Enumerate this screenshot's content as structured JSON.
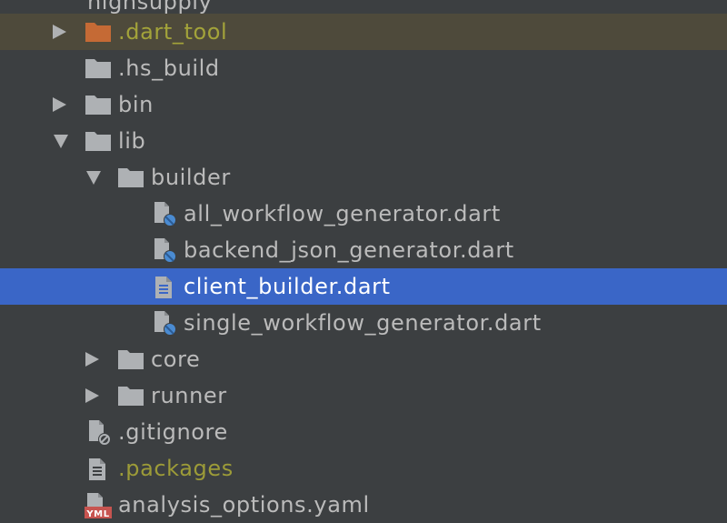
{
  "tree": {
    "root_partial": "highsupply",
    "items": [
      {
        "label": ".dart_tool",
        "icon": "folder-excluded-icon",
        "expanded": false,
        "depth": 0
      },
      {
        "label": ".hs_build",
        "icon": "folder-icon",
        "depth": 0
      },
      {
        "label": "bin",
        "icon": "folder-icon",
        "expanded": false,
        "depth": 0
      },
      {
        "label": "lib",
        "icon": "folder-icon",
        "expanded": true,
        "depth": 0
      },
      {
        "label": "builder",
        "icon": "folder-icon",
        "expanded": true,
        "depth": 1
      },
      {
        "label": "all_workflow_generator.dart",
        "icon": "dart-file-icon",
        "depth": 2
      },
      {
        "label": "backend_json_generator.dart",
        "icon": "dart-file-icon",
        "depth": 2
      },
      {
        "label": "client_builder.dart",
        "icon": "text-file-icon",
        "depth": 2,
        "selected": true
      },
      {
        "label": "single_workflow_generator.dart",
        "icon": "dart-file-icon",
        "depth": 2
      },
      {
        "label": "core",
        "icon": "folder-icon",
        "expanded": false,
        "depth": 1
      },
      {
        "label": "runner",
        "icon": "folder-icon",
        "expanded": false,
        "depth": 1
      },
      {
        "label": ".gitignore",
        "icon": "ignore-file-icon",
        "depth": 0
      },
      {
        "label": ".packages",
        "icon": "text-file-icon",
        "depth": 0
      },
      {
        "label": "analysis_options.yaml",
        "icon": "yaml-file-icon",
        "depth": 0
      }
    ]
  },
  "colors": {
    "background": "#3c3f41",
    "selection": "#3a66c7",
    "excluded_row": "#4e4a3b",
    "excluded_text": "#a3a33a",
    "folder": "#aeb1b4",
    "folder_excluded": "#c56a35"
  }
}
